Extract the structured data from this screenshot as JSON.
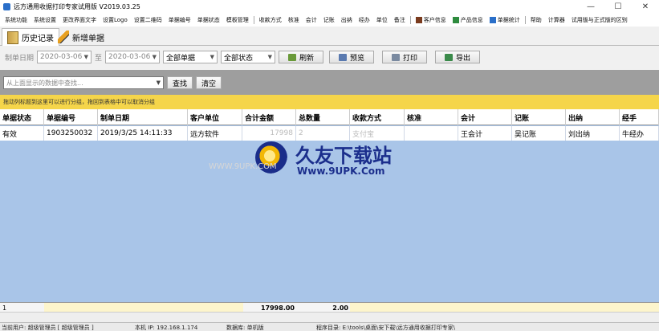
{
  "window": {
    "title": "远方通用收据打印专家试用版 V2019.03.25",
    "controls": [
      "—",
      "☐",
      "✕"
    ]
  },
  "menu": {
    "items": [
      "系统功能",
      "系统设置",
      "更改界面文字",
      "设置Logo",
      "设置二维码",
      "单据编号",
      "单据状态",
      "模板管理"
    ],
    "items2": [
      "收款方式",
      "核准",
      "会计",
      "记账",
      "出纳",
      "经办",
      "单位",
      "备注"
    ],
    "items3": [
      "客户信息",
      "产品信息",
      "单据统计"
    ],
    "items4": [
      "帮助",
      "计算器",
      "试用版与正式版的区别"
    ]
  },
  "tabs": [
    {
      "label": "历史记录",
      "active": true
    },
    {
      "label": "新增单据",
      "active": false
    }
  ],
  "toolbar": {
    "date_label": "制单日期",
    "date_from": "2020-03-06",
    "to_label": "至",
    "date_to": "2020-03-06",
    "type_select": "全部单据",
    "status_select": "全部状态",
    "refresh": "刷新",
    "preview": "预览",
    "print": "打印",
    "export": "导出"
  },
  "search": {
    "placeholder": "从上面显示的数据中查找...",
    "find": "查找",
    "clear": "清空"
  },
  "group_hint": "拖动列标题到这里可以进行分组，拖回到表格中可以取消分组",
  "table": {
    "headers": [
      "单据状态",
      "单据编号",
      "制单日期",
      "客户单位",
      "合计金额",
      "总数量",
      "收款方式",
      "核准",
      "会计",
      "记账",
      "出纳",
      "经手"
    ],
    "rows": [
      [
        "有效",
        "1903250032",
        "2019/3/25 14:11:33",
        "远方软件",
        "17998",
        "2",
        "支付宝",
        "",
        "王会计",
        "吴记账",
        "刘出纳",
        "牛经办"
      ]
    ]
  },
  "footer": {
    "count": "1",
    "total_amount": "17998.00",
    "total_qty": "2.00"
  },
  "status": {
    "user": "当前用户: 超级管理员 [ 超级管理员 ]",
    "ip": "本机 IP: 192.168.1.174",
    "db": "数据库: 单机版",
    "dir": "程序目录: E:\\tools\\桌面\\安下载\\远方通用收据打印专家\\"
  },
  "watermark": {
    "title": "久友下载站",
    "url": "Www.9UPK.Com",
    "faint": "WWW.9UPK.COM"
  },
  "colors": {
    "group_bar": "#f5d54a",
    "grid_bg": "#a9c5e8",
    "search_panel": "#9e9e9e"
  }
}
